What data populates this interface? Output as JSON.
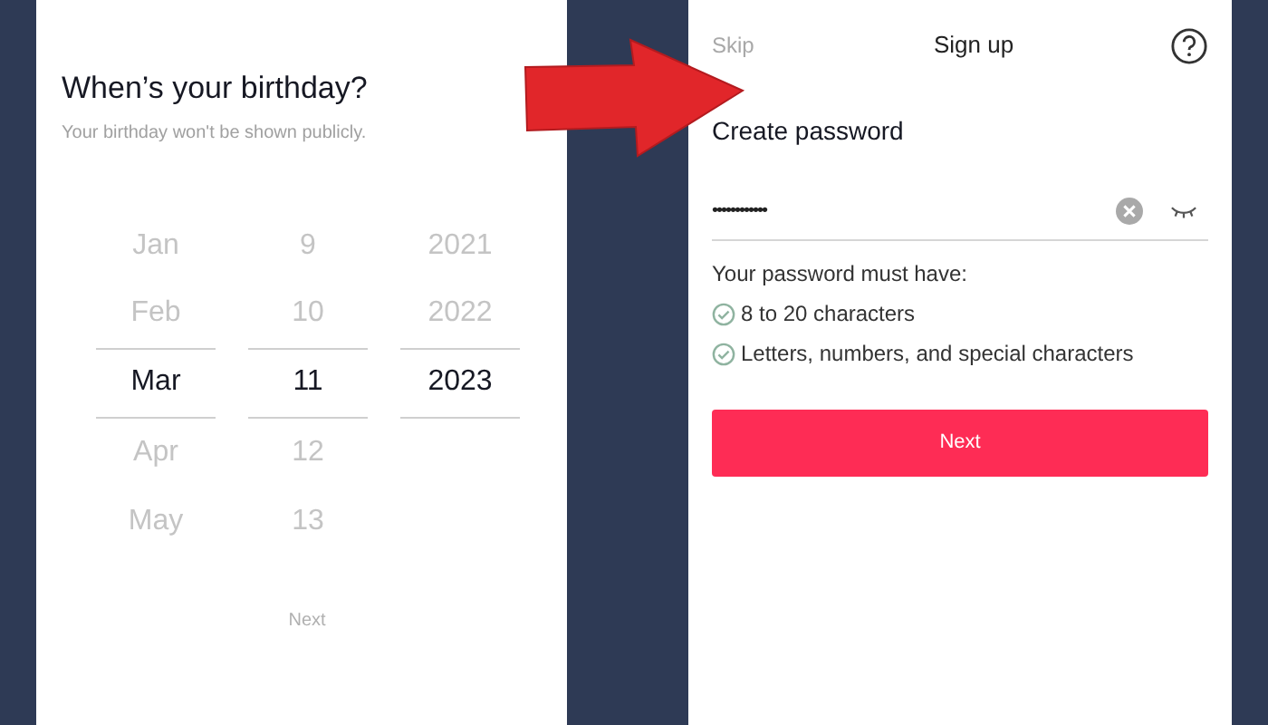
{
  "birthday_screen": {
    "title": "When’s your birthday?",
    "subtitle": "Your birthday won't be shown publicly.",
    "picker": [
      {
        "items": [
          {
            "label": "Jan",
            "selected": false
          },
          {
            "label": "Feb",
            "selected": false
          },
          {
            "label": "Mar",
            "selected": true
          },
          {
            "label": "Apr",
            "selected": false
          },
          {
            "label": "May",
            "selected": false
          }
        ]
      },
      {
        "items": [
          {
            "label": "9",
            "selected": false
          },
          {
            "label": "10",
            "selected": false
          },
          {
            "label": "11",
            "selected": true
          },
          {
            "label": "12",
            "selected": false
          },
          {
            "label": "13",
            "selected": false
          }
        ]
      },
      {
        "items": [
          {
            "label": "2021",
            "selected": false
          },
          {
            "label": "2022",
            "selected": false
          },
          {
            "label": "2023",
            "selected": true
          }
        ]
      }
    ],
    "next_button": {
      "label": "Next",
      "disabled": true
    }
  },
  "password_screen": {
    "skip": "Skip",
    "title": "Sign up",
    "heading": "Create password",
    "password_value": "••••••••••••",
    "rules_title": "Your password must have:",
    "rules": [
      {
        "text": "8 to 20 characters",
        "met": true
      },
      {
        "text": "Letters, numbers, and special characters",
        "met": true
      }
    ],
    "next_button": {
      "label": "Next",
      "disabled": false
    }
  }
}
